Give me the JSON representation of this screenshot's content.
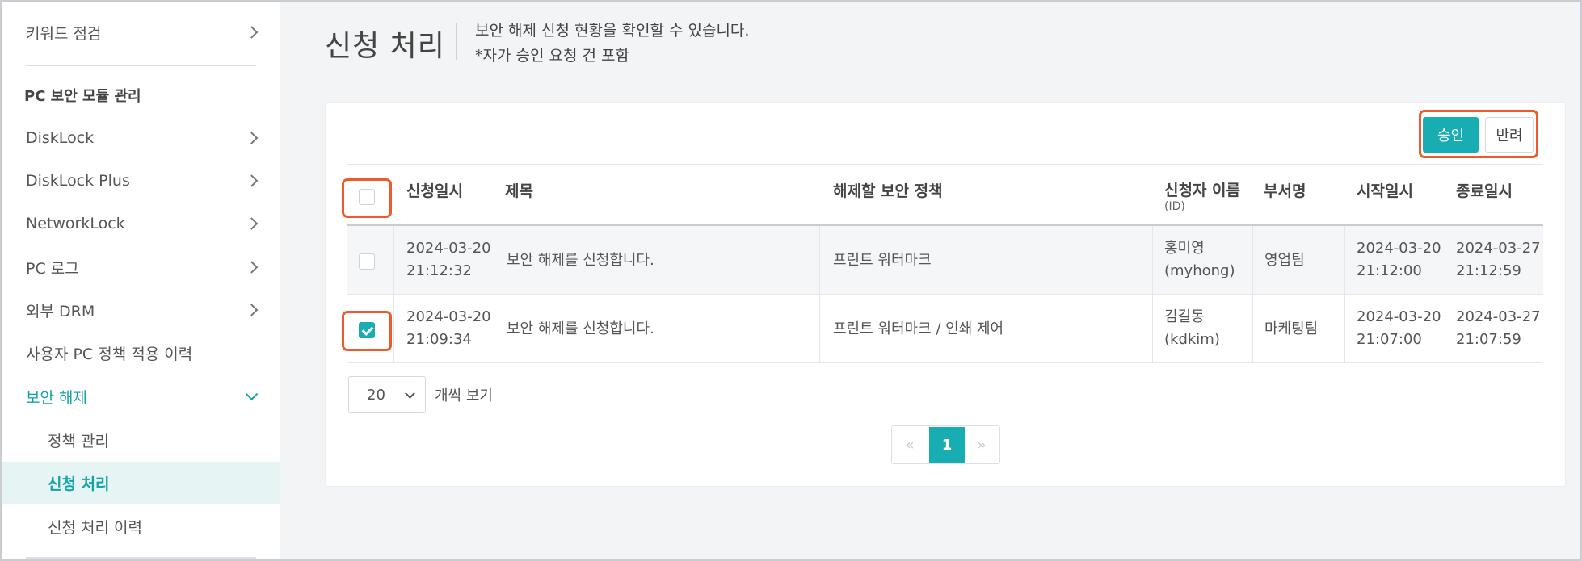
{
  "sidebar": {
    "top_item": "키워드 점검",
    "section_title": "PC 보안 모듈 관리",
    "items": [
      "DiskLock",
      "DiskLock Plus",
      "NetworkLock",
      "PC 로그",
      "외부 DRM",
      "사용자 PC 정책 적용 이력"
    ],
    "active_parent": "보안 해제",
    "sub_items": [
      "정책 관리",
      "신청 처리",
      "신청 처리 이력"
    ]
  },
  "header": {
    "title": "신청 처리",
    "desc_line1": "보안 해제 신청 현황을 확인할 수 있습니다.",
    "desc_line2": "*자가 승인 요청 건 포함"
  },
  "actions": {
    "approve": "승인",
    "reject": "반려"
  },
  "table": {
    "headers": {
      "date": "신청일시",
      "title": "제목",
      "policy": "해제할 보안 정책",
      "applicant": "신청자 이름",
      "applicant_sub": "(ID)",
      "dept": "부서명",
      "start": "시작일시",
      "end": "종료일시"
    },
    "rows": [
      {
        "date": "2024-03-20",
        "time": "21:12:32",
        "title": "보안 해제를 신청합니다.",
        "policy": "프린트 워터마크",
        "name": "홍미영",
        "id": "(myhong)",
        "dept": "영업팀",
        "start_date": "2024-03-20",
        "start_time": "21:12:00",
        "end_date": "2024-03-27",
        "end_time": "21:12:59",
        "checked": false
      },
      {
        "date": "2024-03-20",
        "time": "21:09:34",
        "title": "보안 해제를 신청합니다.",
        "policy": "프린트 워터마크 / 인쇄 제어",
        "name": "김길동",
        "id": "(kdkim)",
        "dept": "마케팅팀",
        "start_date": "2024-03-20",
        "start_time": "21:07:00",
        "end_date": "2024-03-27",
        "end_time": "21:07:59",
        "checked": true
      }
    ]
  },
  "pagination": {
    "page_size": "20",
    "page_size_label": "개씩 보기",
    "prev": "«",
    "current": "1",
    "next": "»"
  },
  "colors": {
    "accent": "#17adb3",
    "highlight": "#f05a2a"
  }
}
